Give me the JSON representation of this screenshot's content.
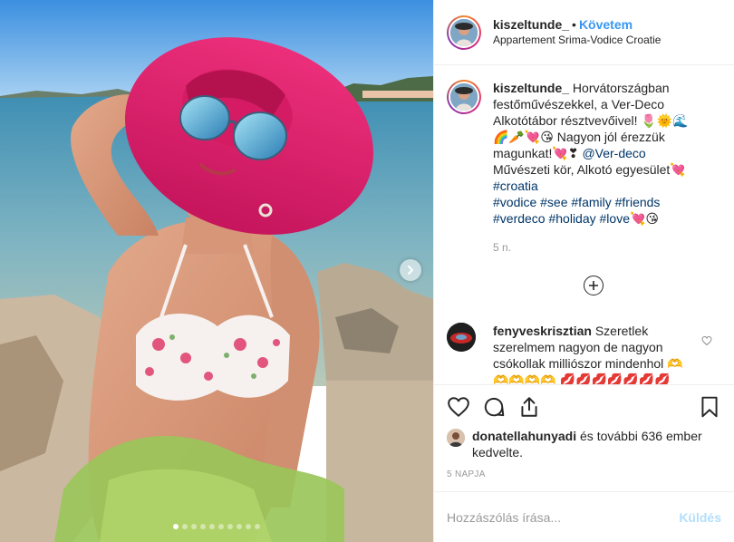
{
  "photo": {
    "alt": "",
    "carousel_count": 10,
    "carousel_active": 0
  },
  "header": {
    "username": "kiszeltunde_",
    "separator": "•",
    "follow_label": "Követem",
    "location": "Appartement Srima-Vodice Croatie"
  },
  "caption": {
    "username": "kiszeltunde_",
    "text1": "Horvátországban festőművészekkel, a Ver-Deco Alkotótábor résztvevőivel! 🌷🌞🌊🌈🥕💘😘 Nagyon jól érezzük magunkat!💘❣ ",
    "mention": "@Ver-deco",
    "text2": " Művészeti kör, Alkotó egyesület💘",
    "hashtags_line1": "#croatia",
    "hashtags_line2": "#vodice #see #family #friends",
    "hashtags_line3": "#verdeco #holiday #love",
    "emoji_end": "💘😘",
    "time": "5 n."
  },
  "comment": {
    "username": "fenyveskrisztian",
    "text": "Szeretlek szerelmem nagyon de nagyon csókollak milliószor mindenhol 🫶🫶🫶🫶🫶 💋💋💋💋💋💋💋💋❤️❤️❤️❤️❤️❤️😘😘😘😘😘😘😘😘😘😘"
  },
  "likes": {
    "user": "donatellahunyadi",
    "text": " és további 636 ember kedvelte."
  },
  "timestamp": "5 NAPJA",
  "add_comment": {
    "placeholder": "Hozzászólás írása...",
    "send_label": "Küldés"
  },
  "icons": [
    "heart-icon",
    "comment-icon",
    "share-icon",
    "bookmark-icon",
    "plus-circle-icon",
    "chevron-right-icon"
  ],
  "colors": {
    "link": "#3897f0",
    "hashtag": "#003569",
    "muted": "#999999",
    "send_disabled": "#b2dffc"
  }
}
